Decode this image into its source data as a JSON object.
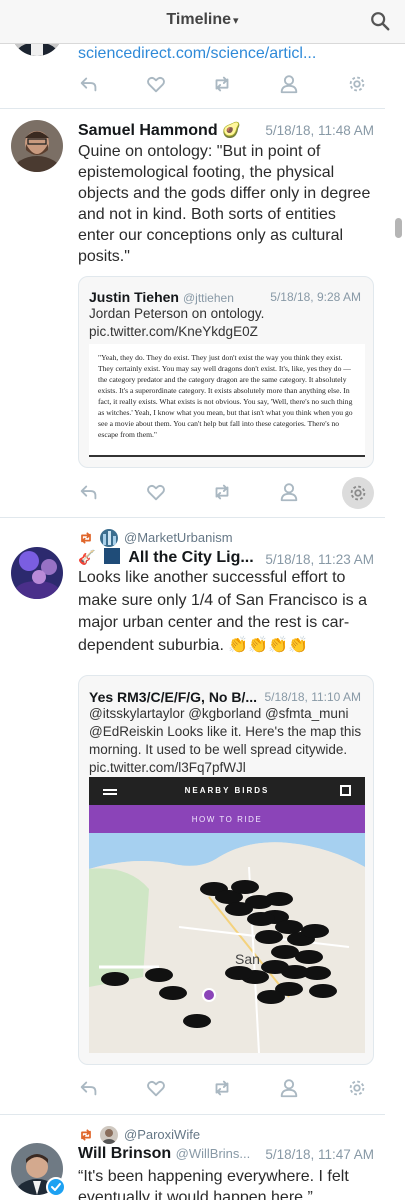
{
  "header": {
    "title": "Timeline",
    "caret": "▾"
  },
  "tweet0": {
    "link": "sciencedirect.com/science/articl..."
  },
  "tweet1": {
    "name": "Samuel Hammond",
    "emoji": "🥑",
    "time": "5/18/18, 11:48 AM",
    "text": "Quine on ontology: \"But in point of epistemological footing, the physical objects and the gods differ only in degree and not in kind. Both sorts of entities enter our conceptions only as cultural posits.\"",
    "quote": {
      "name": "Justin Tiehen",
      "handle": "@jttiehen",
      "time": "5/18/18, 9:28 AM",
      "text": "Jordan Peterson on ontology. pic.twitter.com/KneYkdgE0Z",
      "image_text": "\"Yeah, they do. They do exist. They just don't exist the way you think they exist. They certainly exist. You may say well dragons don't exist. It's, like, yes they do — the category predator and the category dragon are the same category. It absolutely exists. It's a superordinate category. It exists absolutely more than anything else. In fact, it really exists. What exists is not obvious. You say, 'Well, there's no such thing as witches.' Yeah, I know what you mean, but that isn't what you think when you go see a movie about them. You can't help but fall into these categories. There's no escape from them.\""
    }
  },
  "tweet2": {
    "retweeted_by": "@MarketUrbanism",
    "name": "All the City Lig...",
    "time": "5/18/18, 11:23 AM",
    "text": "Looks like another successful effort to make sure only 1/4 of San Francisco is a major urban center  and the rest is car-dependent suburbia. 👏👏👏👏",
    "quote": {
      "name": "Yes RM3/C/E/F/G, No B/...",
      "time": "5/18/18, 11:10 AM",
      "text": "@itsskylartaylor @kgborland @sfmta_muni @EdReiskin Looks like it. Here's the map this morning. It used to be well spread citywide. pic.twitter.com/l3Fq7pfWJl",
      "map_title": "NEARBY BIRDS",
      "map_cta": "HOW TO RIDE",
      "map_label": "San"
    }
  },
  "tweet3": {
    "retweeted_by": "@ParoxiWife",
    "name": "Will Brinson",
    "handle": "@WillBrins...",
    "time": "5/18/18, 11:47 AM",
    "text": "“It's been happening everywhere. I felt eventually it would happen here.”"
  },
  "colors": {
    "link": "#2f8ad8",
    "retweet": "#e0662b",
    "purple": "#8b44b8",
    "verified": "#1da1f2"
  }
}
